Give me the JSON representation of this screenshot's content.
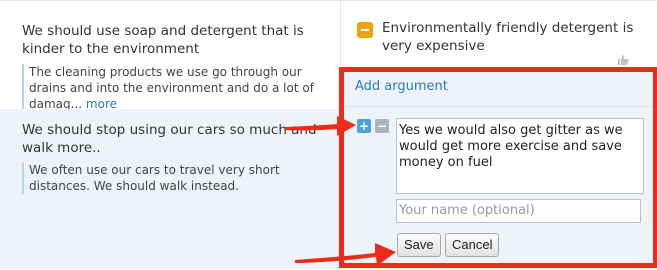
{
  "arguments_for": [
    {
      "title": "We should use soap and detergent that is kinder to the environment",
      "description": "The cleaning products we use go through our drains and into the environment and do a lot of damag...",
      "more_label": "more"
    },
    {
      "title": "We should stop using our cars so much and walk more..",
      "description": "We often use our cars to travel very short distances. We should walk instead."
    }
  ],
  "argument_against": {
    "title": "Environmentally friendly detergent is very expensive"
  },
  "add_argument_form": {
    "add_link_label": "Add argument",
    "plus_label": "+",
    "minus_label": "−",
    "text_value": "Yes we would also get gitter as we would get more exercise and save money on fuel",
    "name_placeholder": "Your name (optional)",
    "save_label": "Save",
    "cancel_label": "Cancel"
  },
  "colors": {
    "link": "#2a7ab8",
    "panel_background": "#edf3f8",
    "against_badge": "#f0a20c",
    "annotation_red": "#ee2a1a"
  }
}
